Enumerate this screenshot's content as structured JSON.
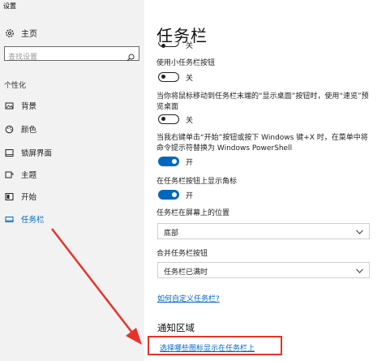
{
  "window": {
    "title": "设置"
  },
  "sidebar": {
    "home_label": "主页",
    "search_placeholder": "查找设置",
    "section_label": "个性化",
    "items": [
      {
        "label": "背景",
        "icon": "image-icon"
      },
      {
        "label": "颜色",
        "icon": "palette-icon"
      },
      {
        "label": "锁屏界面",
        "icon": "lock-screen-icon"
      },
      {
        "label": "主题",
        "icon": "theme-icon"
      },
      {
        "label": "开始",
        "icon": "start-icon"
      },
      {
        "label": "任务栏",
        "icon": "taskbar-icon",
        "active": true
      }
    ]
  },
  "main": {
    "title": "任务栏",
    "top_toggle_state": "关",
    "options": [
      {
        "label": "使用小任务栏按钮",
        "state": "关",
        "on": false
      },
      {
        "label": "当你将鼠标移动到任务栏末端的“显示桌面”按钮时，使用“速览”预览桌面",
        "state": "关",
        "on": false
      },
      {
        "label": "当我右键单击“开始”按钮或按下 Windows 键+X 时，在菜单中将命令提示符替换为 Windows PowerShell",
        "state": "开",
        "on": true
      },
      {
        "label": "在任务栏按钮上显示角标",
        "state": "开",
        "on": true
      }
    ],
    "position": {
      "label": "任务栏在屏幕上的位置",
      "value": "底部"
    },
    "combine": {
      "label": "合并任务栏按钮",
      "value": "任务栏已满时"
    },
    "customize_link": "如何自定义任务栏?",
    "notification": {
      "title": "通知区域",
      "link": "选择哪些图标显示在任务栏上"
    }
  },
  "colors": {
    "accent": "#0067c0",
    "annotation_red": "#e5332a",
    "sidebar_bg": "#f2f2f2"
  }
}
